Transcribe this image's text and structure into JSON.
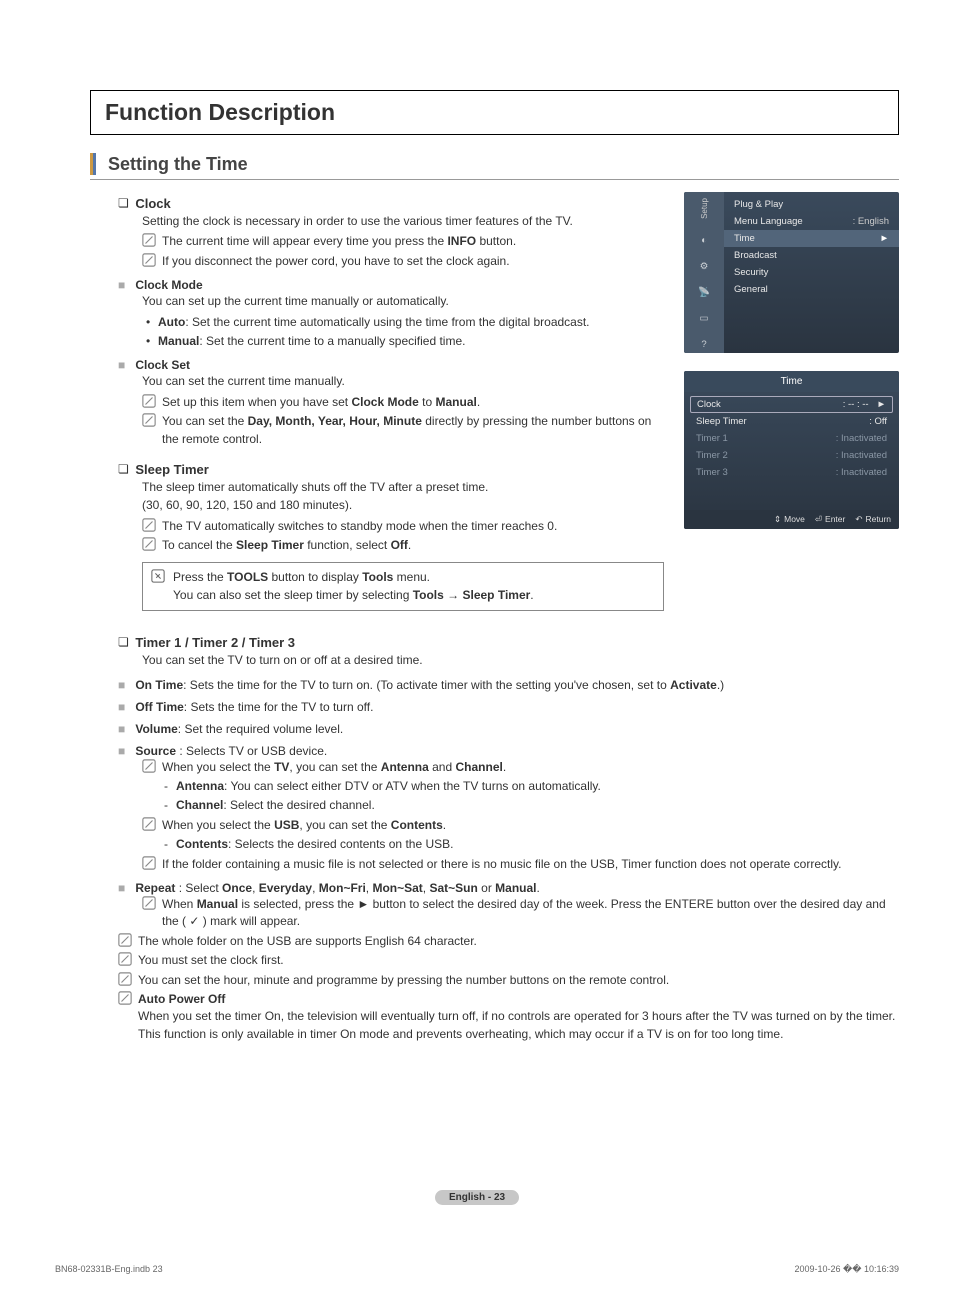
{
  "mainTitle": "Function Description",
  "sectionTitle": "Setting the Time",
  "clock": {
    "title": "Clock",
    "intro": "Setting the clock is necessary in order to use the various timer features of the TV.",
    "note1_pre": "The current time will appear every time you press the ",
    "note1_bold": "INFO",
    "note1_post": " button.",
    "note2": "If you disconnect the power cord, you have to set the clock again.",
    "mode": {
      "title": "Clock Mode",
      "intro": "You can set up the current time manually or automatically.",
      "auto_label": "Auto",
      "auto_text": ": Set the current time automatically using the time from the digital broadcast.",
      "manual_label": "Manual",
      "manual_text": ": Set the current time to a manually specified time."
    },
    "set": {
      "title": "Clock Set",
      "intro": "You can set the current time manually.",
      "note1_pre": "Set up this item when you have set ",
      "note1_b1": "Clock Mode",
      "note1_mid": " to ",
      "note1_b2": "Manual",
      "note1_post": ".",
      "note2_pre": "You can set the ",
      "note2_bold": "Day, Month, Year, Hour, Minute",
      "note2_post": " directly by pressing the number buttons on the remote control."
    }
  },
  "sleepTimer": {
    "title": "Sleep Timer",
    "line1": "The sleep timer automatically shuts off the TV after a preset time.",
    "line2": "(30, 60, 90, 120, 150 and 180 minutes).",
    "note1": "The TV automatically switches to standby mode when the timer reaches 0.",
    "note2_pre": "To cancel the ",
    "note2_b1": "Sleep Timer",
    "note2_mid": " function, select ",
    "note2_b2": "Off",
    "note2_post": ".",
    "tip_l1_pre": "Press the ",
    "tip_l1_b1": "TOOLS",
    "tip_l1_mid": " button to display ",
    "tip_l1_b2": "Tools",
    "tip_l1_post": " menu.",
    "tip_l2_pre": "You can also set the sleep timer by selecting ",
    "tip_l2_b1": "Tools → Sleep Timer",
    "tip_l2_post": "."
  },
  "timers": {
    "title": "Timer 1 / Timer 2 / Timer 3",
    "intro": "You can set the TV to turn on or off at a desired time.",
    "onTime_label": "On Time",
    "onTime_text_pre": ": Sets the time for the TV to turn on. (To activate timer with the setting you've chosen, set to ",
    "onTime_text_bold": "Activate",
    "onTime_text_post": ".)",
    "offTime_label": "Off Time",
    "offTime_text": ": Sets the time for the TV to turn off.",
    "volume_label": "Volume",
    "volume_text": ": Set the required volume level.",
    "source_label": "Source",
    "source_text": " : Selects TV or USB device.",
    "src_note1_pre": "When you select the ",
    "src_note1_b1": "TV",
    "src_note1_mid": ", you can set the ",
    "src_note1_b2": "Antenna",
    "src_note1_mid2": " and ",
    "src_note1_b3": "Channel",
    "src_note1_post": ".",
    "antenna_label": "Antenna",
    "antenna_text": ": You can select either DTV or ATV when the TV turns on automatically.",
    "channel_label": "Channel",
    "channel_text": ": Select the desired channel.",
    "src_note2_pre": "When you select the ",
    "src_note2_b1": "USB",
    "src_note2_mid": ", you can set the ",
    "src_note2_b2": "Contents",
    "src_note2_post": ".",
    "contents_label": "Contents",
    "contents_text": ": Selects the desired contents on the USB.",
    "src_note3": "If the folder containing a music file is not selected or there is no music file on the USB, Timer function does not operate correctly.",
    "repeat_label": "Repeat",
    "repeat_text_pre": " : Select ",
    "repeat_opts": [
      "Once",
      "Everyday",
      "Mon~Fri",
      "Mon~Sat",
      "Sat~Sun",
      "Manual"
    ],
    "repeat_or": " or ",
    "repeat_note_pre": "When ",
    "repeat_note_b1": "Manual",
    "repeat_note_mid": " is selected, press the ► button to select the desired day of the week. Press the ENTER",
    "repeat_note_enter": "E",
    "repeat_note_post": " button over the desired day and the ( ✓ ) mark will appear.",
    "gnote1": "The whole folder on the USB are supports English 64 character.",
    "gnote2": "You must set the clock first.",
    "gnote3": "You can set the hour, minute and programme by pressing the number buttons on the remote control.",
    "autoOff_label": "Auto Power Off",
    "autoOff_text": "When you set the timer On, the television will eventually turn off, if no controls are operated for 3 hours after the TV was turned on by the timer. This function is only available in timer On mode and prevents overheating, which may occur if a TV is on for too long time."
  },
  "osdSetup": {
    "sidebar_label": "Setup",
    "rows": [
      {
        "label": "Plug & Play",
        "value": ""
      },
      {
        "label": "Menu Language",
        "value": ": English"
      },
      {
        "label": "Time",
        "value": "",
        "selected": true,
        "arrow": true
      },
      {
        "label": "Broadcast",
        "value": ""
      },
      {
        "label": "Security",
        "value": ""
      },
      {
        "label": "General",
        "value": ""
      }
    ]
  },
  "osdTime": {
    "title": "Time",
    "rows": [
      {
        "label": "Clock",
        "value": ": -- : --",
        "selected": true,
        "arrow": true
      },
      {
        "label": "Sleep Timer",
        "value": ": Off"
      },
      {
        "label": "Timer 1",
        "value": ": Inactivated",
        "dim": true
      },
      {
        "label": "Timer 2",
        "value": ": Inactivated",
        "dim": true
      },
      {
        "label": "Timer 3",
        "value": ": Inactivated",
        "dim": true
      }
    ],
    "footer": {
      "move": "Move",
      "enter": "Enter",
      "return": "Return"
    }
  },
  "footerPage": "English - 23",
  "meta": {
    "left": "BN68-02331B-Eng.indb   23",
    "right": "2009-10-26   �� 10:16:39"
  }
}
